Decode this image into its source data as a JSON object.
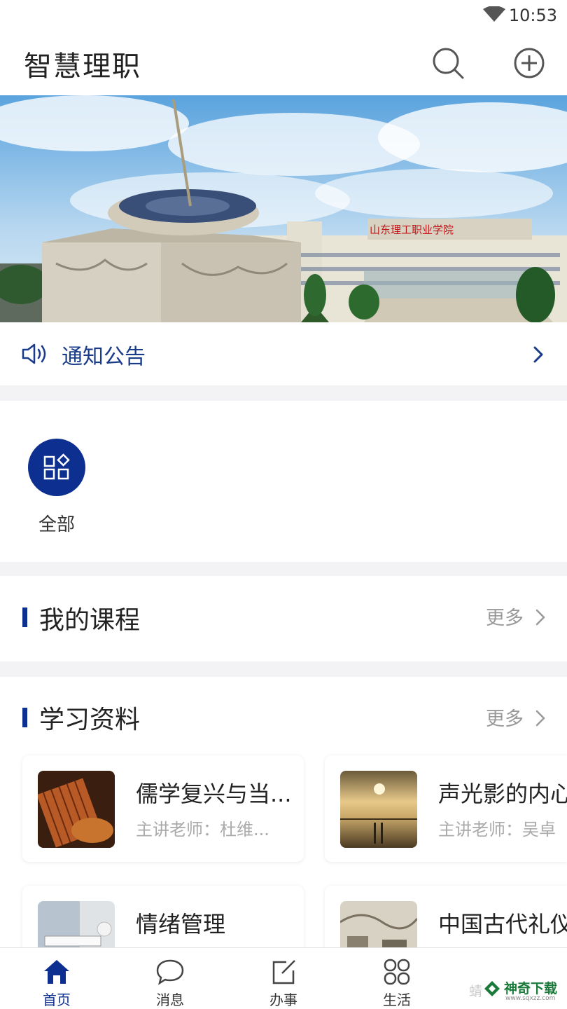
{
  "status_bar": {
    "time": "10:53"
  },
  "header": {
    "title": "智慧理职"
  },
  "notice": {
    "label": "通知公告"
  },
  "apps": [
    {
      "label": "全部"
    }
  ],
  "sections": {
    "courses": {
      "title": "我的课程",
      "more": "更多"
    },
    "materials": {
      "title": "学习资料",
      "more": "更多",
      "items": [
        {
          "title": "儒学复兴与当...",
          "teacher": "主讲老师：杜维..."
        },
        {
          "title": "声光影的内心",
          "teacher": "主讲老师：吴卓"
        },
        {
          "title": "情绪管理",
          "teacher": ""
        },
        {
          "title": "中国古代礼仪",
          "teacher": ""
        }
      ]
    }
  },
  "tabs": [
    {
      "label": "首页",
      "active": true
    },
    {
      "label": "消息",
      "active": false
    },
    {
      "label": "办事",
      "active": false
    },
    {
      "label": "生活",
      "active": false
    }
  ],
  "watermark": {
    "brand": "神奇下载",
    "faded": "蜻",
    "site": "www.sqxzz.com"
  },
  "colors": {
    "primary": "#0d2f8f",
    "bg": "#f3f3f5",
    "muted": "#999999"
  },
  "banner": {
    "sign_text": "山东理工职业学院"
  }
}
